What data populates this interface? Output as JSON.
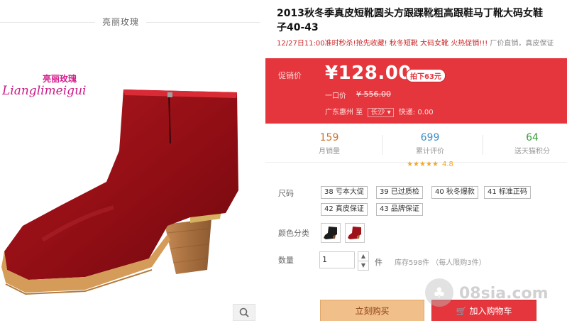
{
  "brand": {
    "top_label": "亮丽玫瑰",
    "logo_cn": "亮丽玫瑰",
    "logo_en": "Lianglimeigui"
  },
  "product": {
    "title_line1": "2013秋冬季真皮短靴圆头方跟踝靴粗高跟鞋马丁靴大码女鞋",
    "title_line2": "子40-43",
    "promo_red": "12/27日11:00准时秒杀!抢先收藏! 秋冬短靴 大码女靴 火热促销!!! ",
    "promo_gray": "厂价直销，真皮保证"
  },
  "price": {
    "label": "促销价",
    "current": "¥128.00",
    "badge": "拍下63元",
    "orig_label": "一口价",
    "orig": "¥ 556.00",
    "ship_from": "广东惠州",
    "ship_to_label": "至",
    "ship_city": "长沙",
    "ship_fee": "快递: 0.00"
  },
  "stats": {
    "sales": {
      "value": "159",
      "label": "月销量"
    },
    "reviews": {
      "value": "699",
      "label": "累计评价",
      "rating": "4.8"
    },
    "points": {
      "value": "64",
      "label": "送天猫积分"
    }
  },
  "size": {
    "label": "尺码",
    "options": [
      "38 亏本大促",
      "39 已过质检",
      "40 秋冬爆款",
      "41 标准正码",
      "42 真皮保证",
      "43 品牌保证"
    ]
  },
  "color": {
    "label": "颜色分类"
  },
  "quantity": {
    "label": "数量",
    "value": "1",
    "unit": "件",
    "stock": "库存598件 （每人限购3件）"
  },
  "actions": {
    "buy": "立刻购买",
    "cart": "加入购物车"
  },
  "watermark": {
    "text": "08sia.com"
  },
  "colors": {
    "price_red": "#e5363d",
    "sales": "#c9752c",
    "reviews": "#3a8fc9",
    "points": "#3c9c3c"
  }
}
